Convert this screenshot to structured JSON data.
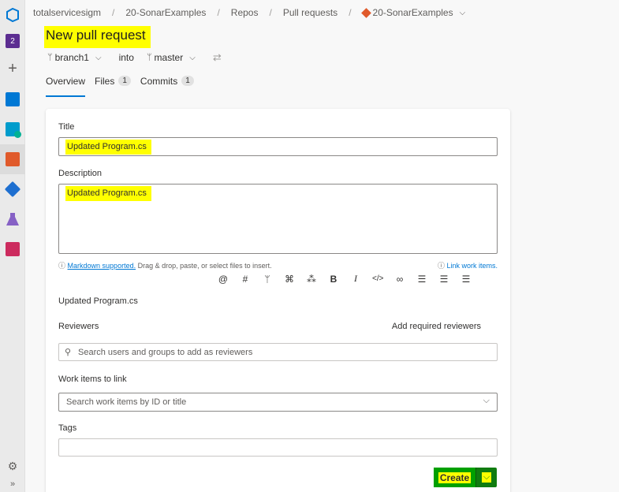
{
  "breadcrumb": {
    "org": "totalservicesigm",
    "project": "20-SonarExamples",
    "section": "Repos",
    "page": "Pull requests",
    "repo": "20-SonarExamples"
  },
  "rail": {
    "badge": "2"
  },
  "page": {
    "title": "New pull request"
  },
  "branches": {
    "source": "branch1",
    "into": "into",
    "target": "master"
  },
  "tabs": [
    {
      "label": "Overview"
    },
    {
      "label": "Files",
      "count": "1"
    },
    {
      "label": "Commits",
      "count": "1"
    }
  ],
  "form": {
    "title_label": "Title",
    "title_value": "Updated Program.cs",
    "description_label": "Description",
    "description_value": "Updated Program.cs",
    "markdown_link": "Markdown supported.",
    "dragdrop_text": "Drag & drop, paste, or select files to insert.",
    "link_work_items": "Link work items.",
    "preview_text": "Updated Program.cs",
    "reviewers_label": "Reviewers",
    "add_required_reviewers": "Add required reviewers",
    "reviewers_placeholder": "Search users and groups to add as reviewers",
    "work_items_label": "Work items to link",
    "work_items_placeholder": "Search work items by ID or title",
    "tags_label": "Tags",
    "create_label": "Create"
  },
  "colors": {
    "accent": "#0078d4",
    "highlight": "#ffff00",
    "create_green": "#107c10"
  }
}
